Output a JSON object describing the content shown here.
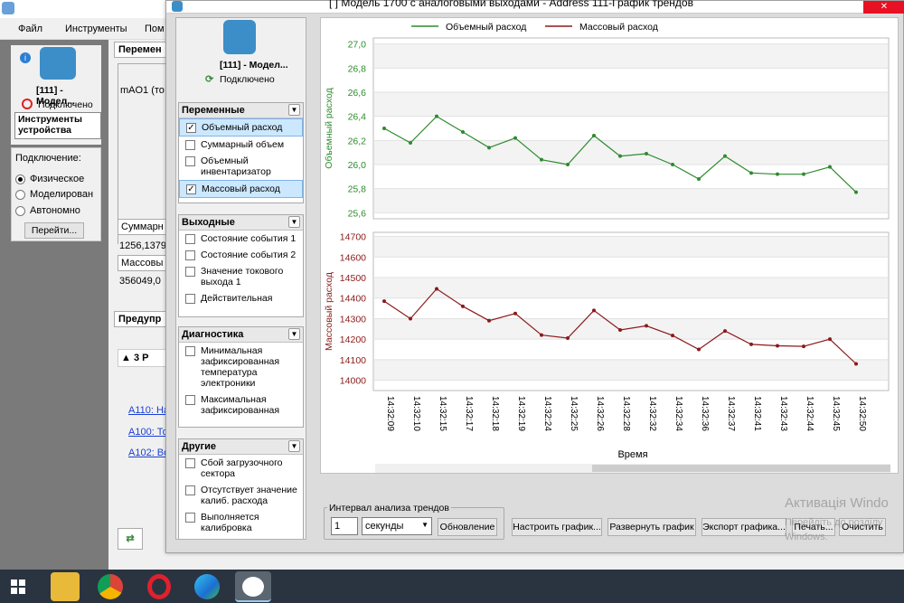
{
  "background_app": {
    "menu": [
      "Файл",
      "Инструменты",
      "Пом"
    ],
    "device_name": "[111] - Модел...",
    "device_status": "Подключено",
    "tools_button": "Инструменты устройства",
    "connection_label": "Подключение:",
    "connection_options": [
      "Физическое",
      "Моделирован",
      "Автономно"
    ],
    "goto_button": "Перейти...",
    "middle": {
      "tab": "Перемен",
      "field1": "mAO1 (то",
      "field2_label": "Суммарн",
      "field2_value": "1256,1379",
      "field3_label": "Массовы",
      "field3_value": "356049,0",
      "warnings_tab": "Предупр",
      "warnings_header": "3 Р",
      "links": [
        "A110: На",
        "A100: То",
        "A102: Во"
      ]
    }
  },
  "trend_window": {
    "title": "[    ] Модель 1700 с аналоговыми выходами - Address 111-График трендов",
    "device_name": "[111] - Модел...",
    "device_status": "Подключено",
    "groups": [
      {
        "title": "Переменные",
        "items": [
          {
            "label": "Объемный расход",
            "checked": true,
            "selected": true
          },
          {
            "label": "Суммарный объем",
            "checked": false,
            "selected": false
          },
          {
            "label": "Объемный инвентаризатор",
            "checked": false,
            "selected": false
          },
          {
            "label": "Массовый расход",
            "checked": true,
            "selected": true
          }
        ]
      },
      {
        "title": "Выходные",
        "items": [
          {
            "label": "Состояние события 1",
            "checked": false
          },
          {
            "label": "Состояние события 2",
            "checked": false
          },
          {
            "label": "Значение токового выхода 1",
            "checked": false
          },
          {
            "label": "Действительная",
            "checked": false
          }
        ]
      },
      {
        "title": "Диагностика",
        "items": [
          {
            "label": "Минимальная зафиксированная температура электроники",
            "checked": false
          },
          {
            "label": "Максимальная зафиксированная",
            "checked": false
          }
        ]
      },
      {
        "title": "Другие",
        "items": [
          {
            "label": "Сбой загрузочного сектора",
            "checked": false
          },
          {
            "label": "Отсутствует значение калиб. расхода",
            "checked": false
          },
          {
            "label": "Выполняется калибровка",
            "checked": false
          }
        ]
      }
    ],
    "interval": {
      "title": "Интервал анализа трендов",
      "value": "1",
      "unit": "секунды",
      "refresh_button": "Обновление"
    },
    "buttons": [
      "Настроить график...",
      "Развернуть график",
      "Экспорт графика...",
      "Печать...",
      "Очистить"
    ]
  },
  "chart_data": [
    {
      "type": "line",
      "legend": [
        "Объемный расход",
        "Массовый расход"
      ],
      "ylabel": "Объемный расход",
      "color": "#2e8b2e",
      "ylim": [
        25.55,
        27.05
      ],
      "yticks": [
        "27,0",
        "26,8",
        "26,6",
        "26,4",
        "26,2",
        "26,0",
        "25,8",
        "25,6"
      ],
      "x": [
        "14:32:09",
        "14:32:10",
        "14:32:15",
        "14:32:17",
        "14:32:18",
        "14:32:19",
        "14:32:24",
        "14:32:25",
        "14:32:26",
        "14:32:28",
        "14:32:32",
        "14:32:34",
        "14:32:36",
        "14:32:37",
        "14:32:41",
        "14:32:43",
        "14:32:44",
        "14:32:45",
        "14:32:50"
      ],
      "values": [
        26.3,
        26.18,
        26.4,
        26.27,
        26.14,
        26.22,
        26.04,
        26.0,
        26.24,
        26.07,
        26.09,
        26.0,
        25.88,
        26.07,
        25.93,
        25.92,
        25.92,
        25.98,
        25.77
      ]
    },
    {
      "type": "line",
      "ylabel": "Массовый расход",
      "xlabel": "Время",
      "color": "#8b1a1a",
      "ylim": [
        13950,
        14720
      ],
      "yticks": [
        "14700",
        "14600",
        "14500",
        "14400",
        "14300",
        "14200",
        "14100",
        "14000"
      ],
      "x": [
        "14:32:09",
        "14:32:10",
        "14:32:15",
        "14:32:17",
        "14:32:18",
        "14:32:19",
        "14:32:24",
        "14:32:25",
        "14:32:26",
        "14:32:28",
        "14:32:32",
        "14:32:34",
        "14:32:36",
        "14:32:37",
        "14:32:41",
        "14:32:43",
        "14:32:44",
        "14:32:45",
        "14:32:50"
      ],
      "values": [
        14385,
        14300,
        14445,
        14360,
        14290,
        14325,
        14220,
        14205,
        14340,
        14245,
        14265,
        14218,
        14150,
        14240,
        14175,
        14168,
        14165,
        14200,
        14080
      ]
    }
  ],
  "watermark": {
    "line1": "Активація Windo",
    "line2": "Перейдіть до розділу",
    "line3": "Windows."
  },
  "colors": {
    "volume": "#2e8b2e",
    "mass": "#8b1a1a",
    "selection": "#cce8ff"
  }
}
